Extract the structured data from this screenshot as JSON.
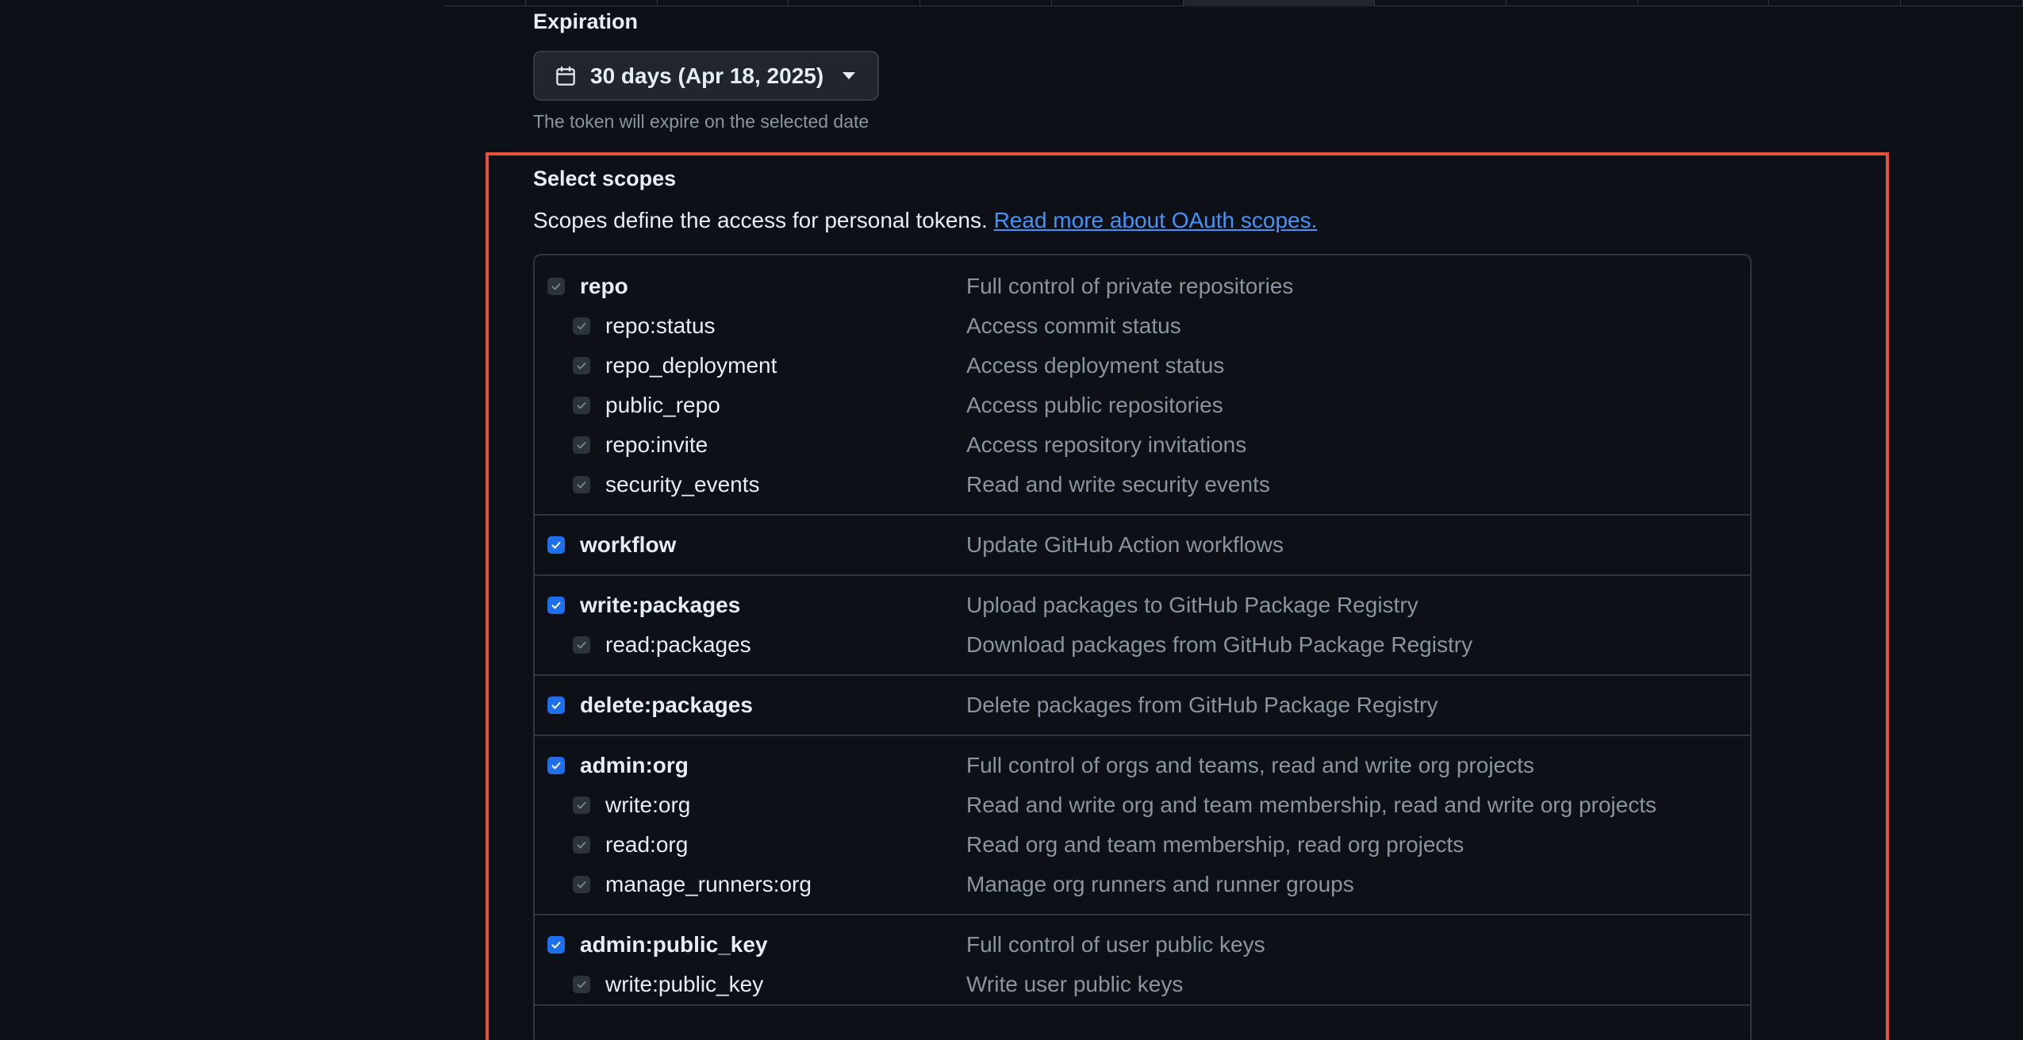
{
  "expiration": {
    "title": "Expiration",
    "selected": "30 days (Apr 18, 2025)",
    "hint": "The token will expire on the selected date"
  },
  "scopes": {
    "title": "Select scopes",
    "description_prefix": "Scopes define the access for personal tokens.",
    "description_link": "Read more about OAuth scopes.",
    "groups": [
      {
        "items": [
          {
            "name": "repo",
            "desc": "Full control of private repositories"
          },
          {
            "name": "repo:status",
            "desc": "Access commit status"
          },
          {
            "name": "repo_deployment",
            "desc": "Access deployment status"
          },
          {
            "name": "public_repo",
            "desc": "Access public repositories"
          },
          {
            "name": "repo:invite",
            "desc": "Access repository invitations"
          },
          {
            "name": "security_events",
            "desc": "Read and write security events"
          }
        ]
      },
      {
        "items": [
          {
            "name": "workflow",
            "desc": "Update GitHub Action workflows"
          }
        ]
      },
      {
        "items": [
          {
            "name": "write:packages",
            "desc": "Upload packages to GitHub Package Registry"
          },
          {
            "name": "read:packages",
            "desc": "Download packages from GitHub Package Registry"
          }
        ]
      },
      {
        "items": [
          {
            "name": "delete:packages",
            "desc": "Delete packages from GitHub Package Registry"
          }
        ]
      },
      {
        "items": [
          {
            "name": "admin:org",
            "desc": "Full control of orgs and teams, read and write org projects"
          },
          {
            "name": "write:org",
            "desc": "Read and write org and team membership, read and write org projects"
          },
          {
            "name": "read:org",
            "desc": "Read org and team membership, read org projects"
          },
          {
            "name": "manage_runners:org",
            "desc": "Manage org runners and runner groups"
          }
        ]
      },
      {
        "items": [
          {
            "name": "admin:public_key",
            "desc": "Full control of user public keys"
          },
          {
            "name": "write:public_key",
            "desc": "Write user public keys"
          }
        ]
      }
    ]
  },
  "icons": {
    "calendar": "calendar-icon",
    "checkmark": "checkmark-icon",
    "caret": "caret-down-icon"
  },
  "colors": {
    "background": "#0d1117",
    "text": "#e6edf3",
    "muted": "#8b949e",
    "border": "#30363d",
    "accent": "#1f6feb",
    "link": "#4493f8",
    "highlight": "#e5533d"
  }
}
